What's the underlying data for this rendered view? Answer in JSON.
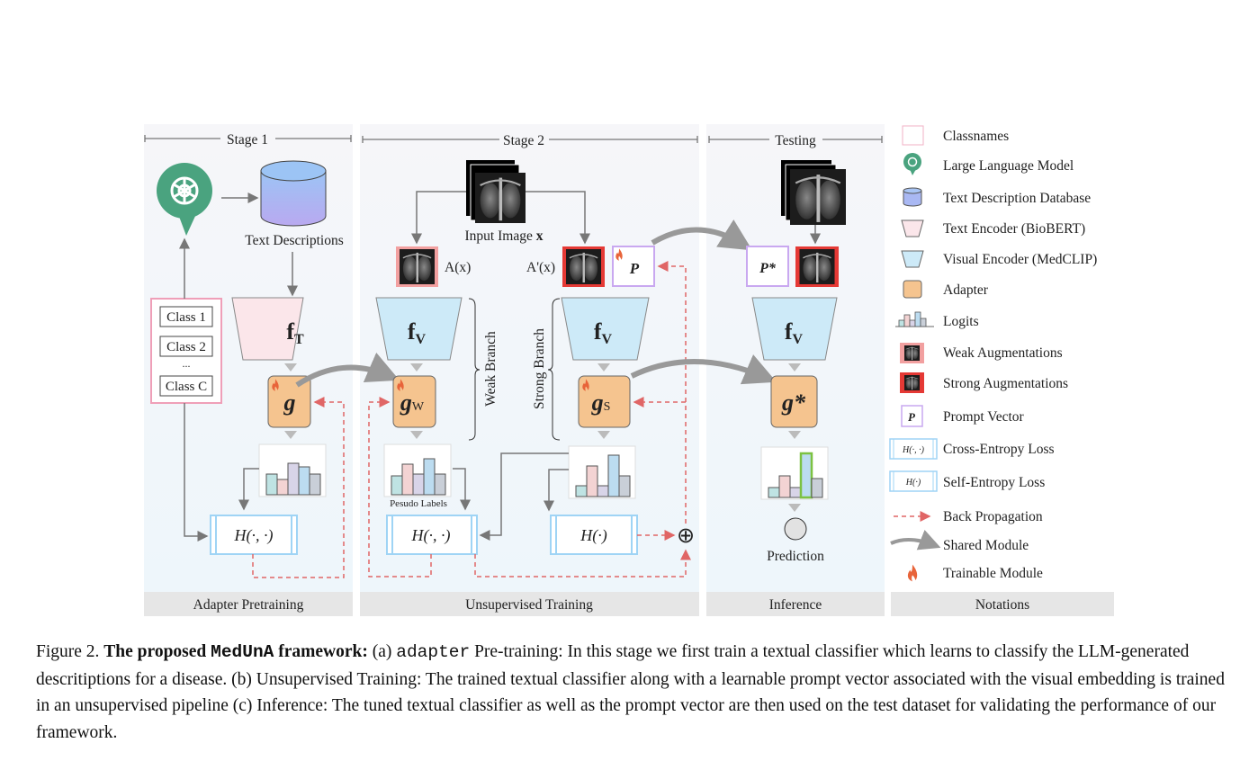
{
  "stages": {
    "stage1": "Stage 1",
    "stage2": "Stage 2",
    "testing": "Testing"
  },
  "panels": {
    "p1": "Adapter Pretraining",
    "p2": "Unsupervised Training",
    "p3": "Inference",
    "p4": "Notations"
  },
  "stage1": {
    "text_descriptions": "Text Descriptions",
    "classes": [
      "Class 1",
      "Class 2",
      "...",
      "Class C"
    ],
    "encoder": {
      "f": "f",
      "sub": "T"
    },
    "adapter": "g",
    "loss": "H(·, ·)"
  },
  "stage2": {
    "input_image": "Input Image ",
    "input_var": "x",
    "weak_aug": "A(x)",
    "strong_aug": "A'(x)",
    "prompt": "P",
    "encoder": {
      "f": "f",
      "sub": "V"
    },
    "weak_branch": "Weak Branch",
    "strong_branch": "Strong Branch",
    "adapter_weak": {
      "g": "g",
      "sub": "W"
    },
    "adapter_strong": {
      "g": "g",
      "sub": "S"
    },
    "pseudo_labels": "Pesudo Labels",
    "loss_cross": "H(·, ·)",
    "loss_self": "H(·)",
    "sum_symbol": "⊕"
  },
  "testing": {
    "prompt": "P*",
    "encoder": {
      "f": "f",
      "sub": "V"
    },
    "adapter": "g*",
    "prediction": "Prediction"
  },
  "legend": [
    {
      "icon": "classnames-box-icon",
      "label": "Classnames"
    },
    {
      "icon": "llm-icon",
      "label": "Large Language Model"
    },
    {
      "icon": "database-icon",
      "label": "Text Description Database"
    },
    {
      "icon": "text-encoder-icon",
      "label": "Text Encoder (BioBERT)"
    },
    {
      "icon": "visual-encoder-icon",
      "label": "Visual Encoder (MedCLIP)"
    },
    {
      "icon": "adapter-icon",
      "label": "Adapter"
    },
    {
      "icon": "logits-icon",
      "label": "Logits"
    },
    {
      "icon": "weak-aug-icon",
      "label": "Weak Augmentations"
    },
    {
      "icon": "strong-aug-icon",
      "label": "Strong Augmentations"
    },
    {
      "icon": "prompt-vector-icon",
      "label": "Prompt Vector",
      "symbol": "P"
    },
    {
      "icon": "cross-entropy-icon",
      "label": "Cross-Entropy Loss",
      "symbol": "H(·, ·)"
    },
    {
      "icon": "self-entropy-icon",
      "label": "Self-Entropy Loss",
      "symbol": "H(·)"
    },
    {
      "icon": "dashed-arrow-icon",
      "label": "Back Propagation"
    },
    {
      "icon": "curved-arrow-icon",
      "label": "Shared Module"
    },
    {
      "icon": "fire-icon",
      "label": "Trainable Module"
    }
  ],
  "colors": {
    "llm": "#4aa37f",
    "adapter": "#f5c48f",
    "text_encoder": "#fbe6ea",
    "visual_encoder": "#cdeaf8",
    "backprop": "#e06666",
    "strong_aug": "#e53935",
    "weak_aug": "#f2a0a0",
    "prompt": "#c9a8f0",
    "loss": "#9fd4f5"
  },
  "caption": {
    "label": "Figure 2. ",
    "bold1": "The proposed ",
    "name": "MedUnA",
    "bold2": " framework:",
    "t1": " (a) ",
    "code": "adapter",
    "t2": " Pre-training: In this stage we first train a textual classifier which learns to classify the LLM-generated descritiptions for a disease. (b) Unsupervised Training: The trained textual classifier along with a learnable prompt vector associated with the visual embedding is trained in an unsupervised pipeline (c) Inference: The tuned textual classifier as well as the prompt vector are then used on the test dataset for validating the performance of our framework."
  }
}
